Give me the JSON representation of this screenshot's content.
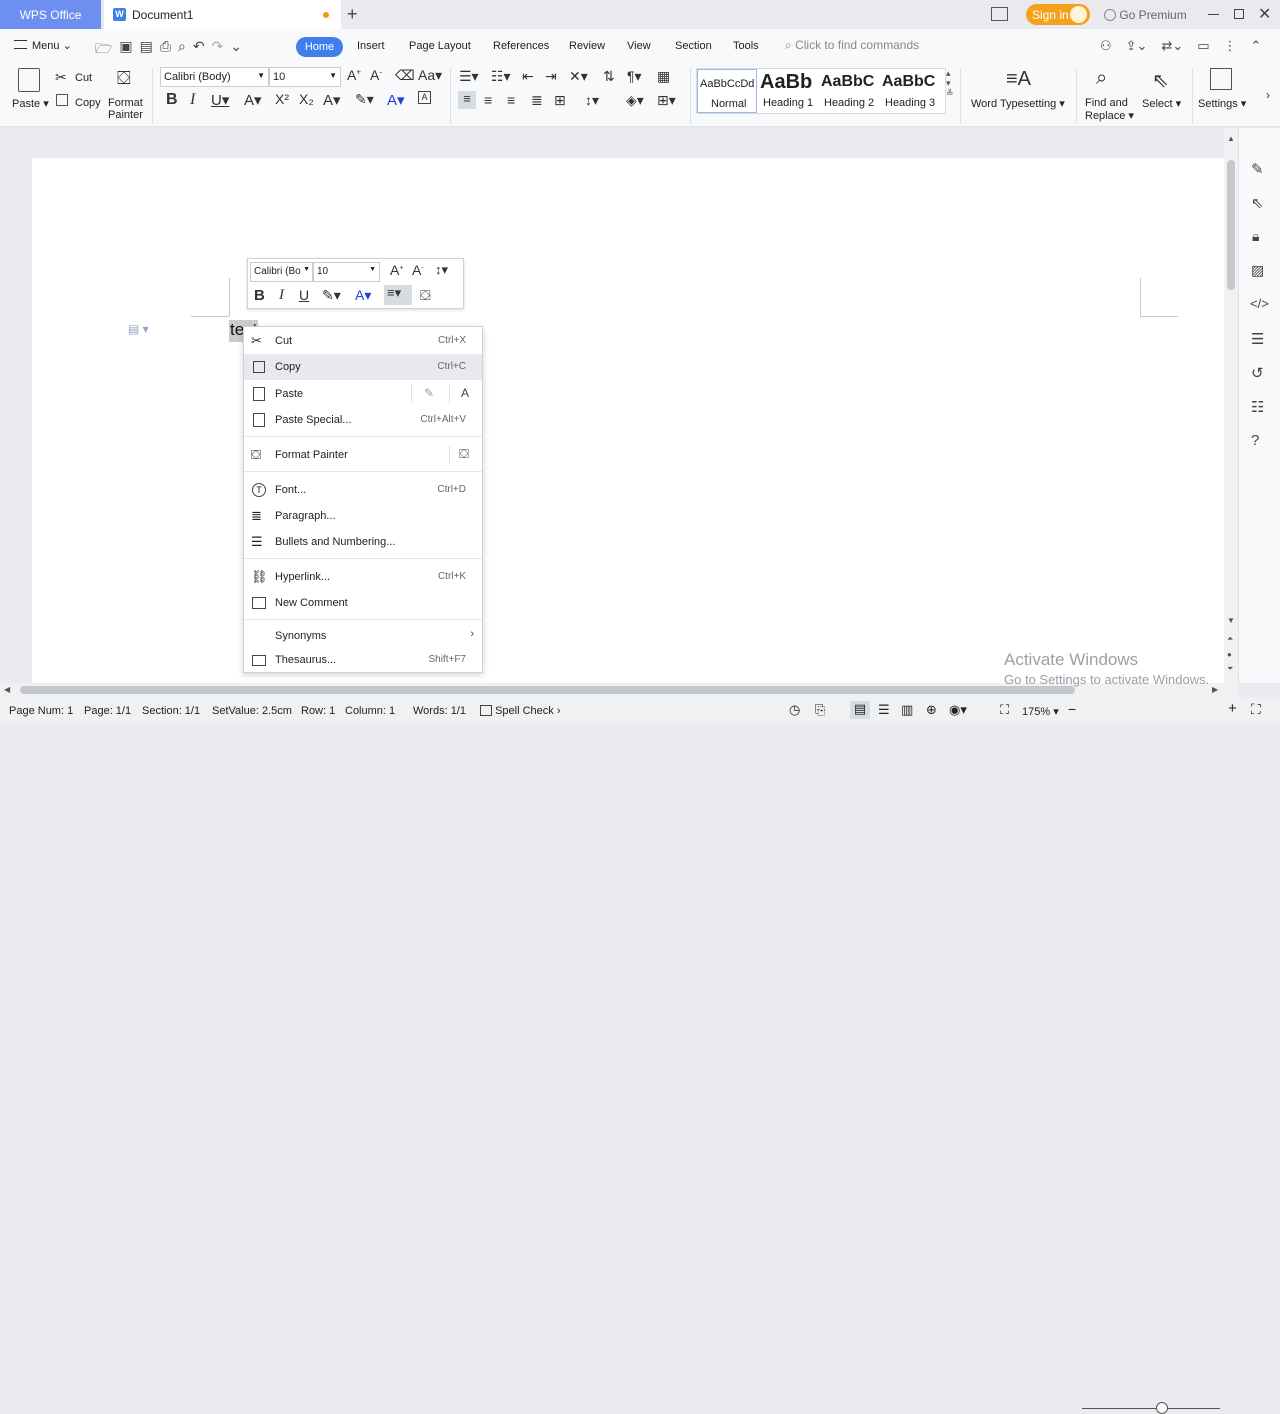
{
  "titlebar": {
    "app_tab": "WPS Office",
    "doc_tab": "Document1",
    "new_tab": "+",
    "sign_in": "Sign in",
    "go_premium": "Go Premium"
  },
  "menubar": {
    "menu": "Menu",
    "tabs": [
      "Home",
      "Insert",
      "Page Layout",
      "References",
      "Review",
      "View",
      "Section",
      "Tools"
    ],
    "search_placeholder": "Click to find commands"
  },
  "toolbar": {
    "paste": "Paste",
    "cut": "Cut",
    "copy": "Copy",
    "format_painter_1": "Format",
    "format_painter_2": "Painter",
    "font_name": "Calibri (Body)",
    "font_size": "10",
    "styles": [
      {
        "preview": "AaBbCcDd",
        "label": "Normal"
      },
      {
        "preview": "AaBb",
        "label": "Heading 1"
      },
      {
        "preview": "AaBbC",
        "label": "Heading 2"
      },
      {
        "preview": "AaBbC",
        "label": "Heading 3"
      }
    ],
    "word_typesetting": "Word Typesetting",
    "find_replace_1": "Find and",
    "find_replace_2": "Replace",
    "select": "Select",
    "settings": "Settings"
  },
  "document": {
    "text": "text"
  },
  "mini_toolbar": {
    "font_name": "Calibri (Bo",
    "font_size": "10"
  },
  "context_menu": {
    "items": [
      {
        "label": "Cut",
        "shortcut": "Ctrl+X"
      },
      {
        "label": "Copy",
        "shortcut": "Ctrl+C"
      },
      {
        "label": "Paste",
        "shortcut": ""
      },
      {
        "label": "Paste Special...",
        "shortcut": "Ctrl+Alt+V"
      },
      {
        "label": "Format Painter",
        "shortcut": ""
      },
      {
        "label": "Font...",
        "shortcut": "Ctrl+D"
      },
      {
        "label": "Paragraph...",
        "shortcut": ""
      },
      {
        "label": "Bullets and Numbering...",
        "shortcut": ""
      },
      {
        "label": "Hyperlink...",
        "shortcut": "Ctrl+K"
      },
      {
        "label": "New Comment",
        "shortcut": ""
      },
      {
        "label": "Synonyms",
        "shortcut": ""
      },
      {
        "label": "Thesaurus...",
        "shortcut": "Shift+F7"
      }
    ]
  },
  "watermark": {
    "line1": "Activate Windows",
    "line2": "Go to Settings to activate Windows."
  },
  "statusbar": {
    "page_num": "Page Num: 1",
    "page": "Page: 1/1",
    "section": "Section: 1/1",
    "set_value": "SetValue: 2.5cm",
    "row": "Row: 1",
    "column": "Column: 1",
    "words": "Words: 1/1",
    "spell_check": "Spell Check",
    "zoom": "175%"
  },
  "colors": {
    "accent": "#3f7fec",
    "wps_tab": "#6d8ff0",
    "sign_in": "#f7a01c",
    "modified_dot": "#f39c12",
    "font_color_bar": "#1f3fd8",
    "highlight_bar": "#f5d800"
  }
}
